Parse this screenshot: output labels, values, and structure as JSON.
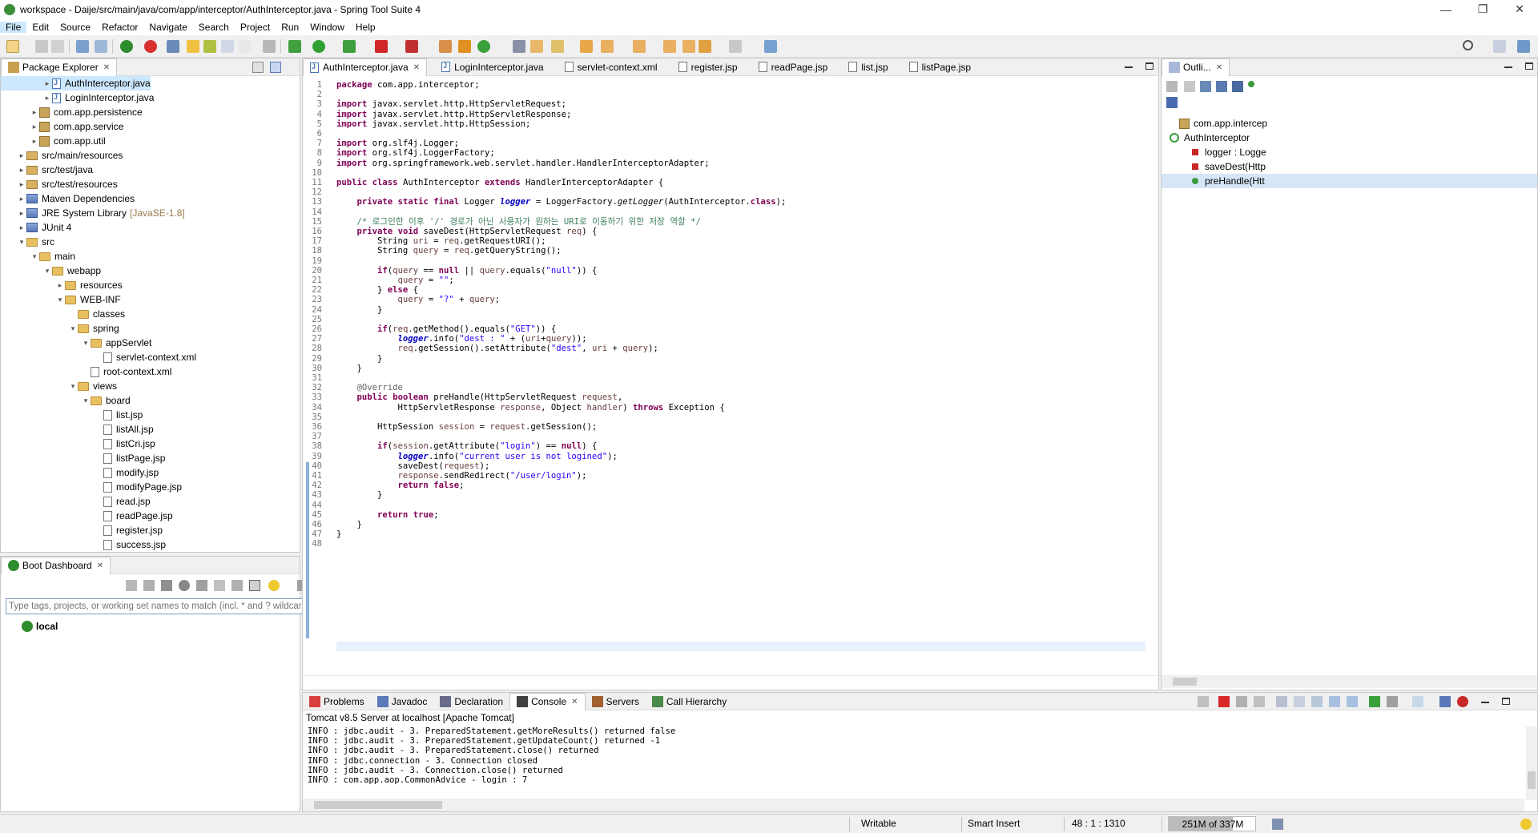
{
  "window": {
    "title": "workspace - Daije/src/main/java/com/app/interceptor/AuthInterceptor.java - Spring Tool Suite 4",
    "minimize": "—",
    "maximize": "❐",
    "close": "✕"
  },
  "menu": [
    "File",
    "Edit",
    "Source",
    "Refactor",
    "Navigate",
    "Search",
    "Project",
    "Run",
    "Window",
    "Help"
  ],
  "package_explorer": {
    "title": "Package Explorer",
    "items": [
      {
        "label": "AuthInterceptor.java",
        "kind": "java",
        "level": 3,
        "twisty": ">"
      },
      {
        "label": "LoginInterceptor.java",
        "kind": "java",
        "level": 3,
        "twisty": ">"
      },
      {
        "label": "com.app.persistence",
        "kind": "pkg",
        "level": 2,
        "twisty": ">"
      },
      {
        "label": "com.app.service",
        "kind": "pkg",
        "level": 2,
        "twisty": ">"
      },
      {
        "label": "com.app.util",
        "kind": "pkg",
        "level": 2,
        "twisty": ">"
      },
      {
        "label": "src/main/resources",
        "kind": "src",
        "level": 1,
        "twisty": ">"
      },
      {
        "label": "src/test/java",
        "kind": "src",
        "level": 1,
        "twisty": ">"
      },
      {
        "label": "src/test/resources",
        "kind": "src",
        "level": 1,
        "twisty": ">"
      },
      {
        "label": "Maven Dependencies",
        "kind": "lib",
        "level": 1,
        "twisty": ">"
      },
      {
        "label": "JRE System Library",
        "extra": "[JavaSE-1.8]",
        "kind": "lib",
        "level": 1,
        "twisty": ">"
      },
      {
        "label": "JUnit 4",
        "kind": "lib",
        "level": 1,
        "twisty": ">"
      },
      {
        "label": "src",
        "kind": "folder",
        "level": 1,
        "twisty": "v"
      },
      {
        "label": "main",
        "kind": "folder",
        "level": 2,
        "twisty": "v"
      },
      {
        "label": "webapp",
        "kind": "folder",
        "level": 3,
        "twisty": "v"
      },
      {
        "label": "resources",
        "kind": "folder",
        "level": 4,
        "twisty": ">"
      },
      {
        "label": "WEB-INF",
        "kind": "folder",
        "level": 4,
        "twisty": "v"
      },
      {
        "label": "classes",
        "kind": "folder",
        "level": 5,
        "twisty": ""
      },
      {
        "label": "spring",
        "kind": "folder",
        "level": 5,
        "twisty": "v"
      },
      {
        "label": "appServlet",
        "kind": "folder",
        "level": 6,
        "twisty": "v"
      },
      {
        "label": "servlet-context.xml",
        "kind": "file",
        "level": 7,
        "twisty": ""
      },
      {
        "label": "root-context.xml",
        "kind": "file",
        "level": 6,
        "twisty": ""
      },
      {
        "label": "views",
        "kind": "folder",
        "level": 5,
        "twisty": "v"
      },
      {
        "label": "board",
        "kind": "folder",
        "level": 6,
        "twisty": "v"
      },
      {
        "label": "list.jsp",
        "kind": "file",
        "level": 7,
        "twisty": ""
      },
      {
        "label": "listAll.jsp",
        "kind": "file",
        "level": 7,
        "twisty": ""
      },
      {
        "label": "listCri.jsp",
        "kind": "file",
        "level": 7,
        "twisty": ""
      },
      {
        "label": "listPage.jsp",
        "kind": "file",
        "level": 7,
        "twisty": ""
      },
      {
        "label": "modify.jsp",
        "kind": "file",
        "level": 7,
        "twisty": ""
      },
      {
        "label": "modifyPage.jsp",
        "kind": "file",
        "level": 7,
        "twisty": ""
      },
      {
        "label": "read.jsp",
        "kind": "file",
        "level": 7,
        "twisty": ""
      },
      {
        "label": "readPage.jsp",
        "kind": "file",
        "level": 7,
        "twisty": ""
      },
      {
        "label": "register.jsp",
        "kind": "file",
        "level": 7,
        "twisty": ""
      },
      {
        "label": "success.jsp",
        "kind": "file",
        "level": 7,
        "twisty": ""
      }
    ]
  },
  "boot_dashboard": {
    "title": "Boot Dashboard",
    "filter_placeholder": "Type tags, projects, or working set names to match (incl. * and ? wildcards)",
    "local_label": "local"
  },
  "editor": {
    "tabs": [
      "AuthInterceptor.java",
      "LoginInterceptor.java",
      "servlet-context.xml",
      "register.jsp",
      "readPage.jsp",
      "list.jsp",
      "listPage.jsp"
    ],
    "line_numbers": [
      "1",
      "2",
      "3",
      "4",
      "5",
      "6",
      "7",
      "8",
      "9",
      "10",
      "11",
      "12",
      "13",
      "14",
      "15",
      "16",
      "17",
      "18",
      "19",
      "20",
      "21",
      "22",
      "23",
      "24",
      "25",
      "26",
      "27",
      "28",
      "29",
      "30",
      "31",
      "32",
      "33",
      "34",
      "35",
      "36",
      "37",
      "38",
      "39",
      "40",
      "41",
      "42",
      "43",
      "44",
      "45",
      "46",
      "47",
      "48"
    ],
    "lines": [
      "package com.app.interceptor;",
      "",
      "import javax.servlet.http.HttpServletRequest;",
      "import javax.servlet.http.HttpServletResponse;",
      "import javax.servlet.http.HttpSession;",
      "",
      "import org.slf4j.Logger;",
      "import org.slf4j.LoggerFactory;",
      "import org.springframework.web.servlet.handler.HandlerInterceptorAdapter;",
      "",
      "public class AuthInterceptor extends HandlerInterceptorAdapter {",
      "",
      "    private static final Logger logger = LoggerFactory.getLogger(AuthInterceptor.class);",
      "",
      "    /* 로그인한 이후 '/' 경로가 아닌 사용자가 원하는 URI로 이동하기 위한 저장 역할 */",
      "    private void saveDest(HttpServletRequest req) {",
      "        String uri = req.getRequestURI();",
      "        String query = req.getQueryString();",
      "",
      "        if(query == null || query.equals(\"null\")) {",
      "            query = \"\";",
      "        } else {",
      "            query = \"?\" + query;",
      "        }",
      "",
      "        if(req.getMethod().equals(\"GET\")) {",
      "            logger.info(\"dest : \" + (uri+query));",
      "            req.getSession().setAttribute(\"dest\", uri + query);",
      "        }",
      "    }",
      "",
      "    @Override",
      "    public boolean preHandle(HttpServletRequest request,",
      "            HttpServletResponse response, Object handler) throws Exception {",
      "",
      "        HttpSession session = request.getSession();",
      "",
      "        if(session.getAttribute(\"login\") == null) {",
      "            logger.info(\"current user is not logined\");",
      "            saveDest(request);",
      "            response.sendRedirect(\"/user/login\");",
      "            return false;",
      "        }",
      "",
      "        return true;",
      "    }",
      "}",
      ""
    ]
  },
  "outline": {
    "title": "Outli...",
    "items": [
      "com.app.intercep",
      "AuthInterceptor",
      "logger : Logge",
      "saveDest(Http",
      "preHandle(Htt"
    ]
  },
  "bottom_tabs": [
    "Problems",
    "Javadoc",
    "Declaration",
    "Console",
    "Servers",
    "Call Hierarchy"
  ],
  "console": {
    "header": "Tomcat v8.5 Server at localhost [Apache Tomcat]",
    "lines": [
      "INFO : jdbc.audit - 3. PreparedStatement.getMoreResults() returned false",
      "INFO : jdbc.audit - 3. PreparedStatement.getUpdateCount() returned -1",
      "INFO : jdbc.audit - 3. PreparedStatement.close() returned",
      "INFO : jdbc.connection - 3. Connection closed",
      "INFO : jdbc.audit - 3. Connection.close() returned",
      "INFO : com.app.aop.CommonAdvice - login : 7"
    ]
  },
  "status": {
    "writable": "Writable",
    "insert_mode": "Smart Insert",
    "position": "48 : 1 : 1310",
    "memory": "251M of 337M",
    "memory_fraction": 0.745
  },
  "colors": {
    "keyword": "#7f0055",
    "string": "#2a00ff",
    "comment": "#3f7f5f",
    "field": "#0000c0",
    "current_line": "#e8f2fe"
  }
}
